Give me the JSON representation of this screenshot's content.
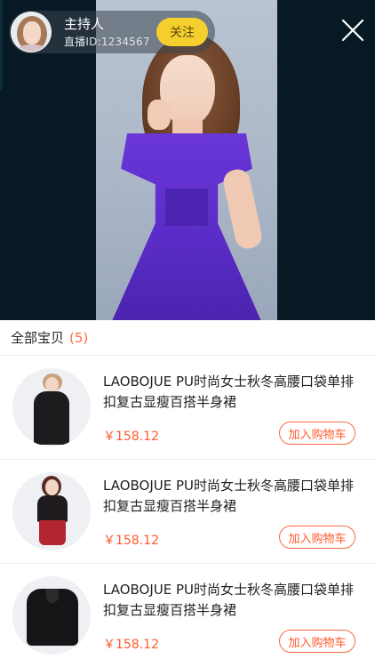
{
  "live": {
    "host_name": "主持人",
    "host_id": "直播ID:1234567",
    "follow_label": "关注"
  },
  "products": {
    "header_label": "全部宝贝",
    "count": "(5)",
    "items": [
      {
        "title": "LAOBOJUE PU时尚女士秋冬高腰口袋单排扣复古显瘦百搭半身裙",
        "price": "￥158.12",
        "cart_label": "加入购物车"
      },
      {
        "title": "LAOBOJUE PU时尚女士秋冬高腰口袋单排扣复古显瘦百搭半身裙",
        "price": "￥158.12",
        "cart_label": "加入购物车"
      },
      {
        "title": "LAOBOJUE PU时尚女士秋冬高腰口袋单排扣复古显瘦百搭半身裙",
        "price": "￥158.12",
        "cart_label": "加入购物车"
      }
    ]
  },
  "colors": {
    "accent": "#ff5a2b",
    "follow": "#f5cf2e",
    "video_bg": "#071a24"
  },
  "icons": [
    "close-icon",
    "avatar"
  ]
}
